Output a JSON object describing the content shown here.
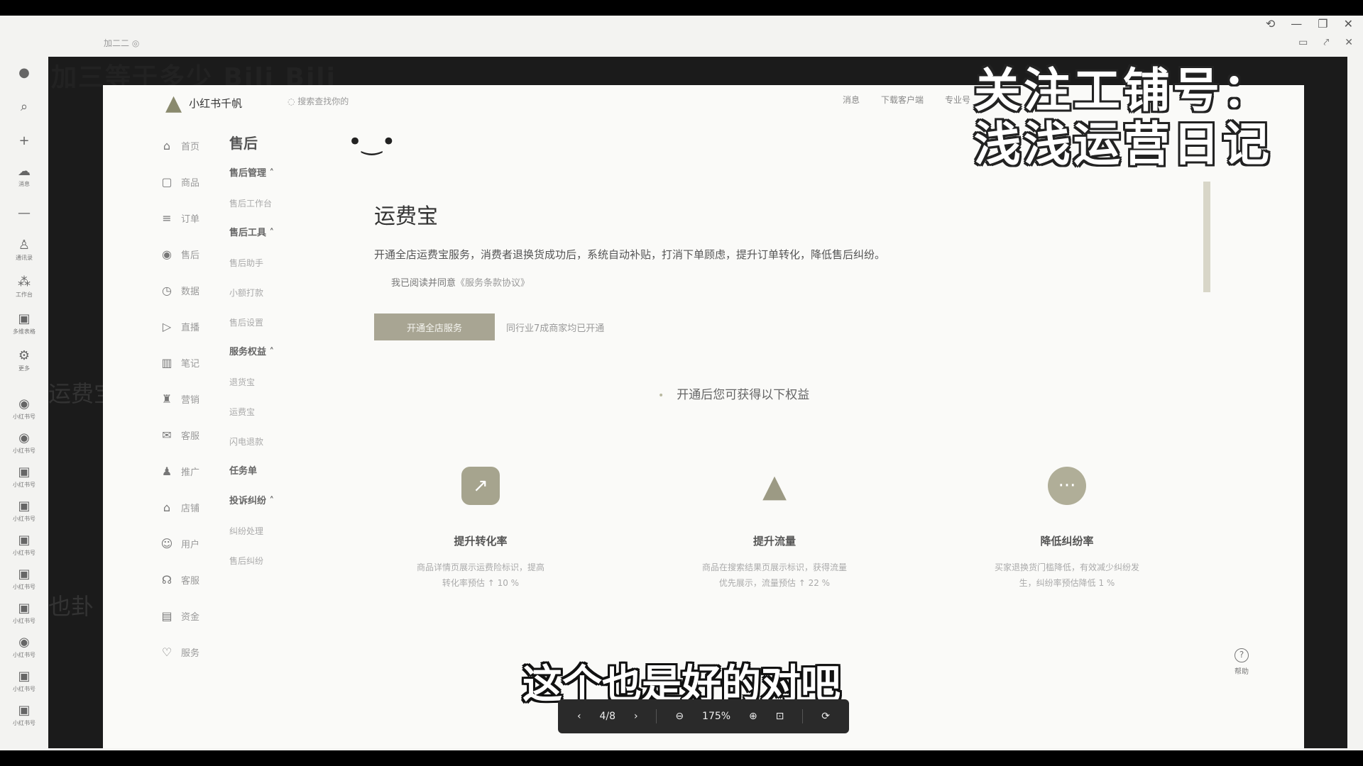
{
  "window": {
    "controls": [
      "⟲",
      "—",
      "❐",
      "✕"
    ],
    "controls2": [
      "▭",
      "⤤",
      "✕"
    ],
    "faded_tab": "加二二 ◎"
  },
  "rail": {
    "top_icons": [
      "●",
      "⌕",
      "+"
    ],
    "apps": [
      {
        "icon": "☁",
        "label": "消息"
      },
      {
        "icon": "—",
        "label": ""
      },
      {
        "icon": "♙",
        "label": "通讯录"
      },
      {
        "icon": "⁂",
        "label": "工作台"
      },
      {
        "icon": "▣",
        "label": "多维表格"
      },
      {
        "icon": "⚙",
        "label": "更多"
      }
    ],
    "recent": [
      "小红书号",
      "小红书号",
      "小红书号",
      "小红书号",
      "小红书号",
      "小红书号",
      "小红书号",
      "小红书号",
      "小红书号",
      "小红书号"
    ]
  },
  "viewer": {
    "behind_title": "加三等于多少 Bili Bili",
    "behind_side": "运费宝",
    "behind_side2": "也卦"
  },
  "page": {
    "brand_name": "小红书千帆",
    "search_hint": "搜索查找你的",
    "top_links": [
      "消息",
      "下载客户端",
      "专业号"
    ],
    "nav": [
      {
        "icon": "⌂",
        "label": "首页"
      },
      {
        "icon": "▢",
        "label": "商品"
      },
      {
        "icon": "≡",
        "label": "订单"
      },
      {
        "icon": "◉",
        "label": "售后"
      },
      {
        "icon": "◷",
        "label": "数据"
      },
      {
        "icon": "▷",
        "label": "直播"
      },
      {
        "icon": "▥",
        "label": "笔记"
      },
      {
        "icon": "♜",
        "label": "营销"
      },
      {
        "icon": "✉",
        "label": "客服"
      },
      {
        "icon": "♟",
        "label": "推广"
      },
      {
        "icon": "⌂",
        "label": "店铺"
      },
      {
        "icon": "☺",
        "label": "用户"
      },
      {
        "icon": "☊",
        "label": "客服"
      },
      {
        "icon": "▤",
        "label": "资金"
      },
      {
        "icon": "♡",
        "label": "服务"
      }
    ],
    "sub": {
      "heading": "售后",
      "groups": [
        {
          "title": "售后管理 ˄",
          "links": [
            "售后工作台"
          ]
        },
        {
          "title": "售后工具 ˄",
          "links": [
            "售后助手",
            "小额打款",
            "售后设置"
          ]
        },
        {
          "title": "服务权益 ˄",
          "links": [
            "退货宝",
            "运费宝",
            "闪电退款"
          ]
        },
        {
          "title": "任务单",
          "links": []
        },
        {
          "title": "投诉纠纷 ˄",
          "links": [
            "纠纷处理",
            "售后纠纷"
          ]
        }
      ]
    },
    "main": {
      "title": "运费宝",
      "description": "开通全店运费宝服务，消费者退换货成功后，系统自动补贴，打消下单顾虑，提升订单转化，降低售后纠纷。",
      "agree_text": "我已阅读并同意",
      "agree_link": "《服务条款协议》",
      "open_button": "开通全店服务",
      "open_note": "同行业7成商家均已开通",
      "benefit_heading": "开通后您可获得以下权益",
      "benefits": [
        {
          "icon": "↗",
          "name": "提升转化率",
          "desc1": "商品详情页展示运费险标识，提高",
          "desc2": "转化率预估 ↑ 10 %"
        },
        {
          "icon": "▲",
          "name": "提升流量",
          "desc1": "商品在搜索结果页展示标识，获得流量",
          "desc2": "优先展示，流量预估 ↑ 22 %"
        },
        {
          "icon": "···",
          "name": "降低纠纷率",
          "desc1": "买家退换货门槛降低，有效减少纠纷发",
          "desc2": "生，纠纷率预估降低 1 %"
        }
      ],
      "help_label": "帮助"
    }
  },
  "watermark": {
    "line1": "关注工铺号：",
    "line2": "浅浅运营日记"
  },
  "subtitle": "这个也是好的对吧",
  "pdf_toolbar": {
    "prev": "‹",
    "page": "4/8",
    "next": "›",
    "zoom_out": "⊖",
    "zoom": "175%",
    "zoom_in": "⊕",
    "fit": "⊡",
    "rotate": "⟳"
  }
}
